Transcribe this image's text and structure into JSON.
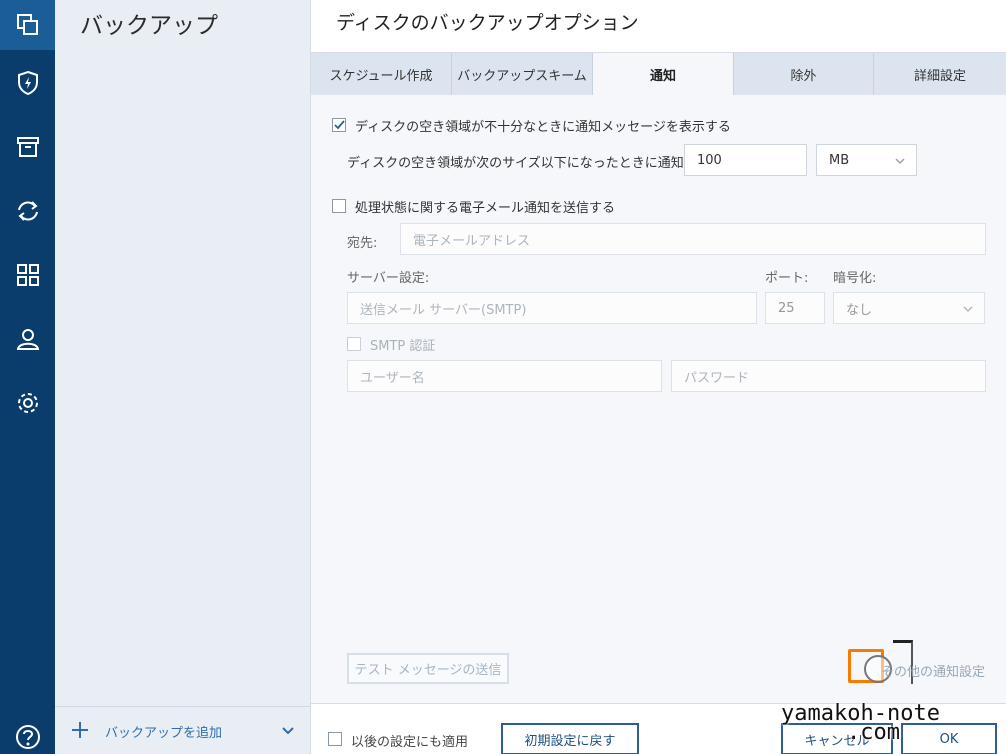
{
  "sidebar": {
    "title": "バックアップ",
    "add_label": "バックアップを追加"
  },
  "dialog": {
    "title": "ディスクのバックアップオプション",
    "tabs": [
      {
        "label": "スケジュール作成"
      },
      {
        "label": "バックアップスキーム"
      },
      {
        "label": "通知"
      },
      {
        "label": "除外"
      },
      {
        "label": "詳細設定"
      }
    ],
    "active_tab": 2
  },
  "notify": {
    "low_space_checkbox_label": "ディスクの空き領域が不十分なときに通知メッセージを表示する",
    "low_space_checked": true,
    "threshold_label": "ディスクの空き領域が次のサイズ以下になったときに通知する:",
    "threshold_value": "100",
    "threshold_unit": "MB",
    "email_checkbox_label": "処理状態に関する電子メール通知を送信する",
    "email_checked": false,
    "to_label": "宛先:",
    "to_placeholder": "電子メールアドレス",
    "server_label": "サーバー設定:",
    "server_placeholder": "送信メール サーバー(SMTP)",
    "port_label": "ポート:",
    "port_value": "25",
    "encryption_label": "暗号化:",
    "encryption_value": "なし",
    "smtp_auth_label": "SMTP 認証",
    "username_placeholder": "ユーザー名",
    "password_placeholder": "パスワード",
    "test_button_label": "テスト メッセージの送信",
    "other_settings_label": "その他の通知設定"
  },
  "footer": {
    "apply_future_label": "以後の設定にも適用",
    "reset_button_label": "初期設定に戻す",
    "cancel_button_label": "キャンセル",
    "ok_button_label": "OK"
  },
  "watermark": {
    "line1": "yamakoh-note",
    "line2": ".com"
  },
  "colors": {
    "rail_bg": "#0a3d6b",
    "rail_active": "#1b5d97",
    "sidebar_bg": "#e9eef4",
    "accent": "#2c5f91",
    "highlight": "#f57c00"
  }
}
